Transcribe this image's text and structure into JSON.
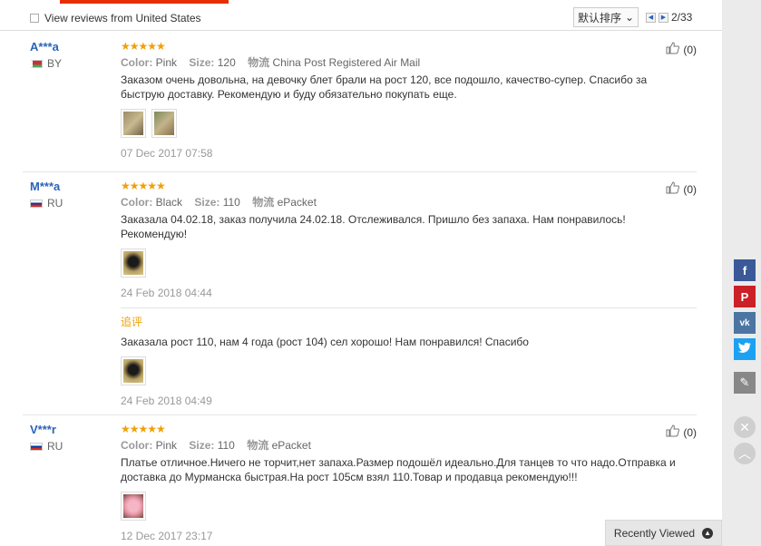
{
  "filter": {
    "label": "View reviews from United States"
  },
  "sort": {
    "selected": "默认排序"
  },
  "pagination": {
    "page": "2/33"
  },
  "reviews": [
    {
      "user": "A***a",
      "country": "BY",
      "color_label": "Color:",
      "color": "Pink",
      "size_label": "Size:",
      "size": "120",
      "shipping_label": "物流",
      "shipping": "China Post Registered Air Mail",
      "text": "Заказом очень довольна, на девочку блет брали на рост 120, все подошло, качество-супер. Спасибо за быструю доставку. Рекомендую и буду обязательно покупать еще.",
      "date": "07 Dec 2017 07:58",
      "helpful": "(0)"
    },
    {
      "user": "M***a",
      "country": "RU",
      "color_label": "Color:",
      "color": "Black",
      "size_label": "Size:",
      "size": "110",
      "shipping_label": "物流",
      "shipping": "ePacket",
      "text": "Заказала 04.02.18, заказ получила 24.02.18. Отслеживался. Пришло без запаха. Нам понравилось! Рекомендую!",
      "date": "24 Feb 2018 04:44",
      "helpful": "(0)",
      "additional": {
        "label": "追评",
        "text": "Заказала рост 110, нам 4 года (рост 104) сел хорошо! Нам понравился! Спасибо",
        "date": "24 Feb 2018 04:49"
      }
    },
    {
      "user": "V***r",
      "country": "RU",
      "color_label": "Color:",
      "color": "Pink",
      "size_label": "Size:",
      "size": "110",
      "shipping_label": "物流",
      "shipping": "ePacket",
      "text": "Платье отличное.Ничего не торчит,нет запаха.Размер подошёл идеально.Для танцев то что надо.Отправка и доставка до Мурманска быстрая.На рост 105см взял 110.Товар и продавца рекомендую!!!",
      "date": "12 Dec 2017 23:17",
      "helpful": "(0)"
    }
  ],
  "recently_viewed": {
    "label": "Recently Viewed"
  },
  "colors": {
    "accent": "#e62e04",
    "link": "#2a63b8",
    "star": "#f0a008"
  }
}
